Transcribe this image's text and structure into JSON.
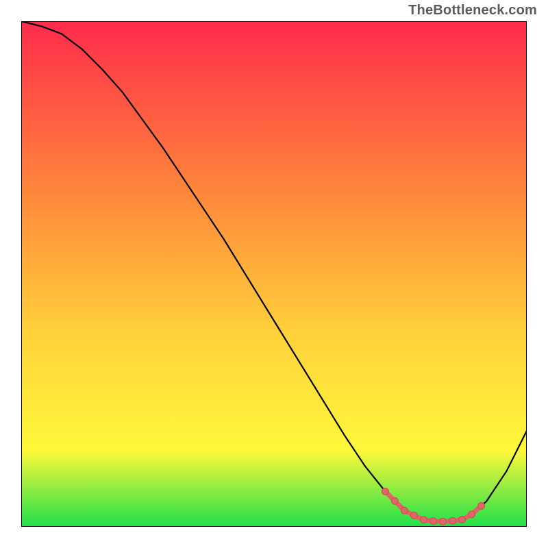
{
  "watermark": "TheBottleneck.com",
  "colors": {
    "gradient_top": "#ff2b4a",
    "gradient_mid1": "#ff8a3a",
    "gradient_mid2": "#ffd23a",
    "gradient_mid3": "#fff83a",
    "gradient_bottom": "#1fe04a",
    "curve": "#000000",
    "marker_fill": "#de6666",
    "marker_stroke": "#c94f4f",
    "border": "#000000"
  },
  "chart_data": {
    "type": "line",
    "title": "",
    "xlabel": "",
    "ylabel": "",
    "xlim": [
      0,
      100
    ],
    "ylim": [
      0,
      100
    ],
    "grid": false,
    "legend": false,
    "x": [
      0,
      4,
      8,
      12,
      16,
      20,
      24,
      28,
      32,
      36,
      40,
      44,
      48,
      52,
      56,
      60,
      64,
      68,
      72,
      76,
      80,
      84,
      88,
      92,
      96,
      100
    ],
    "values": [
      100,
      99,
      97.5,
      94.5,
      90.5,
      86,
      80.5,
      75,
      69,
      63,
      57,
      50.5,
      44,
      37.5,
      31,
      24.5,
      18,
      12,
      7,
      3,
      1.2,
      1,
      1.5,
      5,
      11,
      19
    ],
    "marker_segment": {
      "x_start": 72,
      "x_end": 91
    },
    "note": "y is normalized 0-100 where 0 is the bottom edge of the colored plot area and 100 is the top edge; x similarly 0-100 across the plot width."
  }
}
